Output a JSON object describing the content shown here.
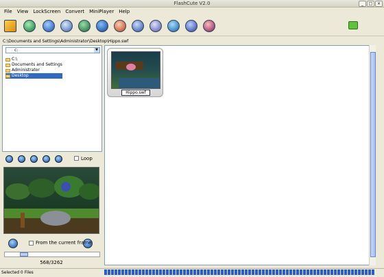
{
  "window": {
    "title": "FlashCute V2.0"
  },
  "menu": [
    "File",
    "View",
    "LockScreen",
    "Convert",
    "MiniPlayer",
    "Help"
  ],
  "toolbar_icons": [
    "open-icon",
    "film-icon",
    "globe-icon",
    "cube-icon",
    "search-globe-icon",
    "sphere-icon",
    "image-icon",
    "wrench-icon",
    "cd-icon",
    "internet-icon",
    "user-icon",
    "question-icon"
  ],
  "path": "C:\\Documents and Settings\\Administrator\\Desktop\\Hippo.swf",
  "drive": "c:",
  "tree": [
    {
      "label": "C:\\",
      "selected": false
    },
    {
      "label": "Documents and Settings",
      "selected": false
    },
    {
      "label": "Administrator",
      "selected": false
    },
    {
      "label": "Desktop",
      "selected": true
    }
  ],
  "player": {
    "loop_label": "Loop",
    "from_current_label": "From the current frame",
    "counter": "568/3262",
    "progress_fraction": 0.174
  },
  "files": [
    {
      "name": "Hippo.swf"
    }
  ],
  "status": {
    "text": "Selected 0 Files"
  }
}
